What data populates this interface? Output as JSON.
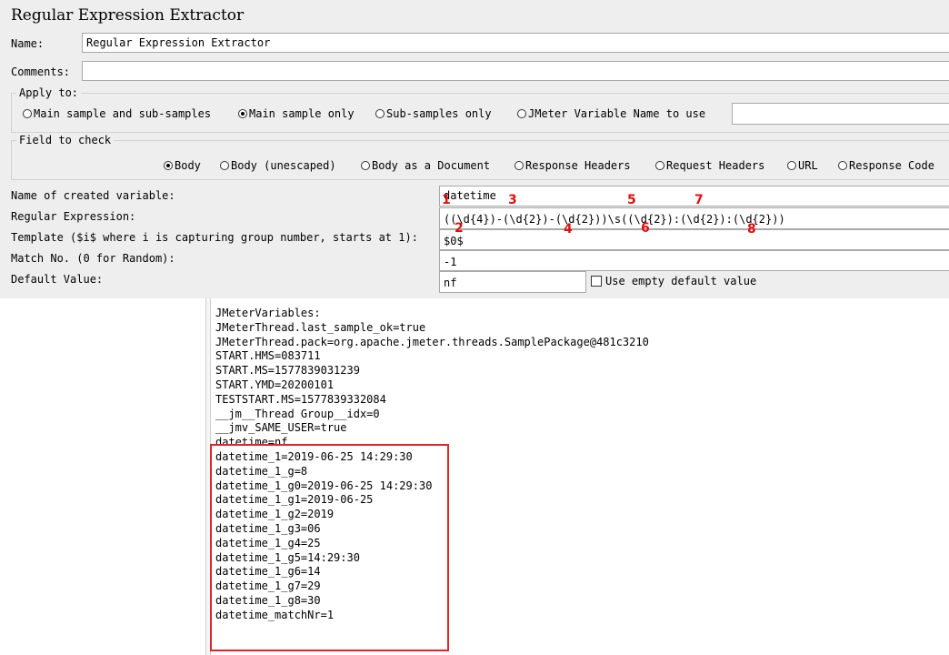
{
  "title": "Regular Expression Extractor",
  "name": {
    "label": "Name:",
    "value": "Regular Expression Extractor"
  },
  "comments": {
    "label": "Comments:",
    "value": ""
  },
  "apply_to": {
    "legend": "Apply to:",
    "options": [
      "Main sample and sub-samples",
      "Main sample only",
      "Sub-samples only",
      "JMeter Variable Name to use"
    ],
    "selected": "Main sample only",
    "variable_value": ""
  },
  "field_to_check": {
    "legend": "Field to check",
    "options": [
      "Body",
      "Body (unescaped)",
      "Body as a Document",
      "Response Headers",
      "Request Headers",
      "URL",
      "Response Code"
    ],
    "selected": "Body"
  },
  "form": {
    "var_name": {
      "label": "Name of created variable:",
      "value": "datetime"
    },
    "regex": {
      "label": "Regular Expression:",
      "value": "((\\d{4})-(\\d{2})-(\\d{2}))\\s((\\d{2}):(\\d{2}):(\\d{2}))"
    },
    "template": {
      "label": "Template ($i$ where i is capturing group number, starts at 1):",
      "value": "$0$"
    },
    "match_no": {
      "label": "Match No. (0 for Random):",
      "value": "-1"
    },
    "default_value": {
      "label": "Default Value:",
      "value": "nf"
    },
    "use_empty_label": "Use empty default value"
  },
  "annotations": [
    "1",
    "2",
    "3",
    "4",
    "5",
    "6",
    "7",
    "8"
  ],
  "annotation_color": "#e01010",
  "variables": [
    "JMeterVariables:",
    "JMeterThread.last_sample_ok=true",
    "JMeterThread.pack=org.apache.jmeter.threads.SamplePackage@481c3210",
    "START.HMS=083711",
    "START.MS=1577839031239",
    "START.YMD=20200101",
    "TESTSTART.MS=1577839332084",
    "__jm__Thread Group__idx=0",
    "__jmv_SAME_USER=true",
    "datetime=nf",
    "datetime_1=2019-06-25 14:29:30",
    "datetime_1_g=8",
    "datetime_1_g0=2019-06-25 14:29:30",
    "datetime_1_g1=2019-06-25",
    "datetime_1_g2=2019",
    "datetime_1_g3=06",
    "datetime_1_g4=25",
    "datetime_1_g5=14:29:30",
    "datetime_1_g6=14",
    "datetime_1_g7=29",
    "datetime_1_g8=30",
    "datetime_matchNr=1"
  ],
  "highlight_color": "#e3222a"
}
